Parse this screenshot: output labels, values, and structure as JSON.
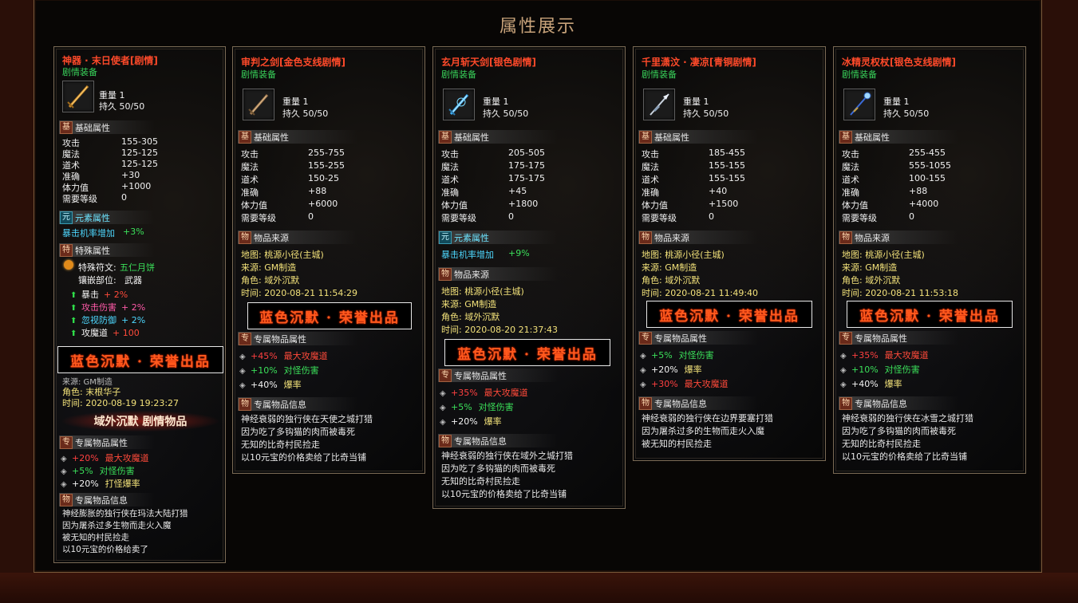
{
  "page": {
    "title": "属性展示"
  },
  "icons": {
    "weapon_card1": "golden-sword-icon",
    "weapon_card2": "bronze-sword-icon",
    "weapon_card3": "ice-sword-icon",
    "weapon_card4": "silver-spear-icon",
    "weapon_card5": "ice-staff-icon"
  },
  "colors": {
    "item_name": "#ff4a2a",
    "plot_equipment": "#39d25a",
    "brand_text": "#ff5a1e",
    "frame_border": "#7a5a3a",
    "title": "#c8a37a"
  },
  "cards": [
    {
      "name": "神器 · 末日使者[剧情]",
      "type": "剧情装备",
      "weight": "重量  1",
      "durability": "持久  50/50",
      "basic_title": "基础属性",
      "basic_badge": "基",
      "basic": [
        {
          "label": "攻击",
          "value": "155-305"
        },
        {
          "label": "魔法",
          "value": "125-125"
        },
        {
          "label": "道术",
          "value": "125-125"
        },
        {
          "label": "准确",
          "value": "+30"
        },
        {
          "label": "体力值",
          "value": "+1000"
        },
        {
          "label": "需要等级",
          "value": "0"
        }
      ],
      "element_badge": "元",
      "element_title": "元素属性",
      "element_stat": "暴击机率增加",
      "element_value": "+3%",
      "special_badge": "特",
      "special_title": "特殊属性",
      "special_rune_label": "特殊符文:",
      "special_rune_value": "五仁月饼",
      "special_slot_label": "镶嵌部位:",
      "special_slot_value": "武器",
      "special_lines": [
        {
          "label": "暴击",
          "value": "+ 2%"
        },
        {
          "label": "攻击伤害",
          "value": "+ 2%"
        },
        {
          "label": "忽视防御",
          "value": "+ 2%"
        },
        {
          "label": "攻魔道",
          "value": "+ 100"
        }
      ],
      "brand": "蓝色沉默 · 荣誉出品",
      "source_partial": "来源:  GM制造",
      "role": "角色:  末根华子",
      "time": "时间:  2020-08-19 19:23:27",
      "plot_banner": "域外沉默  剧情物品",
      "exclusive_badge": "专",
      "exclusive_title": "专属物品属性",
      "exclusive": [
        {
          "pct": "+20%",
          "stat": "最大攻魔道"
        },
        {
          "pct": "+5%",
          "stat": "对怪伤害"
        },
        {
          "pct": "+20%",
          "stat": "打怪爆率"
        }
      ],
      "info_badge": "物",
      "info_title": "专属物品信息",
      "info_lines": [
        "神经膨胀的独行侠在玛法大陆打猎",
        "因为屠杀过多生物而走火入魔",
        "被无知的村民捡走",
        "以10元宝的价格给卖了"
      ]
    },
    {
      "name": "审判之剑[金色支线剧情]",
      "type": "剧情装备",
      "weight": "重量  1",
      "durability": "持久  50/50",
      "basic_badge": "基",
      "basic_title": "基础属性",
      "basic": [
        {
          "label": "攻击",
          "value": "255-755"
        },
        {
          "label": "魔法",
          "value": "155-255"
        },
        {
          "label": "道术",
          "value": "150-25"
        },
        {
          "label": "准确",
          "value": "+88"
        },
        {
          "label": "体力值",
          "value": "+6000"
        },
        {
          "label": "需要等级",
          "value": "0"
        }
      ],
      "source_badge": "物",
      "source_title": "物品来源",
      "map": "地图:  桃源小径(主城)",
      "origin": "来源:  GM制造",
      "role": "角色:  域外沉默",
      "time": "时间:  2020-08-21 11:54:29",
      "brand": "蓝色沉默 · 荣誉出品",
      "exclusive_badge": "专",
      "exclusive_title": "专属物品属性",
      "exclusive": [
        {
          "pct": "+45%",
          "stat": "最大攻魔道"
        },
        {
          "pct": "+10%",
          "stat": "对怪伤害"
        },
        {
          "pct": "+40%",
          "stat": "爆率"
        }
      ],
      "info_badge": "物",
      "info_title": "专属物品信息",
      "info_lines": [
        "神经衰弱的独行侠在天使之城打猎",
        "因为吃了多钩猫的肉而被毒死",
        "无知的比奇村民捡走",
        "以10元宝的价格卖给了比奇当铺"
      ]
    },
    {
      "name": "玄月斩天剑[银色剧情]",
      "type": "剧情装备",
      "weight": "重量  1",
      "durability": "持久  50/50",
      "basic_badge": "基",
      "basic_title": "基础属性",
      "basic": [
        {
          "label": "攻击",
          "value": "205-505"
        },
        {
          "label": "魔法",
          "value": "175-175"
        },
        {
          "label": "道术",
          "value": "175-175"
        },
        {
          "label": "准确",
          "value": "+45"
        },
        {
          "label": "体力值",
          "value": "+1800"
        },
        {
          "label": "需要等级",
          "value": "0"
        }
      ],
      "element_badge": "元",
      "element_title": "元素属性",
      "element_stat": "暴击机率增加",
      "element_value": "+9%",
      "source_badge": "物",
      "source_title": "物品来源",
      "map": "地图:  桃源小径(主城)",
      "origin": "来源:  GM制造",
      "role": "角色:  域外沉默",
      "time": "时间:  2020-08-20 21:37:43",
      "brand": "蓝色沉默 · 荣誉出品",
      "exclusive_badge": "专",
      "exclusive_title": "专属物品属性",
      "exclusive": [
        {
          "pct": "+35%",
          "stat": "最大攻魔道"
        },
        {
          "pct": "+5%",
          "stat": "对怪伤害"
        },
        {
          "pct": "+20%",
          "stat": "爆率"
        }
      ],
      "info_badge": "物",
      "info_title": "专属物品信息",
      "info_lines": [
        "神经衰弱的独行侠在域外之城打猎",
        "因为吃了多钩猫的肉而被毒死",
        "无知的比奇村民捡走",
        "以10元宝的价格卖给了比奇当铺"
      ]
    },
    {
      "name": "千里潇汶 · 凄凉[青铜剧情]",
      "type": "剧情装备",
      "weight": "重量  1",
      "durability": "持久  50/50",
      "basic_badge": "基",
      "basic_title": "基础属性",
      "basic": [
        {
          "label": "攻击",
          "value": "185-455"
        },
        {
          "label": "魔法",
          "value": "155-155"
        },
        {
          "label": "道术",
          "value": "155-155"
        },
        {
          "label": "准确",
          "value": "+40"
        },
        {
          "label": "体力值",
          "value": "+1500"
        },
        {
          "label": "需要等级",
          "value": "0"
        }
      ],
      "source_badge": "物",
      "source_title": "物品来源",
      "map": "地图:  桃源小径(主城)",
      "origin": "来源:  GM制造",
      "role": "角色:  域外沉默",
      "time": "时间:  2020-08-21 11:49:40",
      "brand": "蓝色沉默 · 荣誉出品",
      "exclusive_badge": "专",
      "exclusive_title": "专属物品属性",
      "exclusive": [
        {
          "pct": "+5%",
          "stat": "对怪伤害"
        },
        {
          "pct": "+20%",
          "stat": "爆率"
        },
        {
          "pct": "+30%",
          "stat": "最大攻魔道"
        }
      ],
      "info_badge": "物",
      "info_title": "专属物品信息",
      "info_lines": [
        "神经衰弱的独行侠在边界要塞打猎",
        "因为屠杀过多的生物而走火入魔",
        "被无知的村民捡走"
      ]
    },
    {
      "name": "冰精灵权杖[银色支线剧情]",
      "type": "剧情装备",
      "weight": "重量  1",
      "durability": "持久  50/50",
      "basic_badge": "基",
      "basic_title": "基础属性",
      "basic": [
        {
          "label": "攻击",
          "value": "255-455"
        },
        {
          "label": "魔法",
          "value": "555-1055"
        },
        {
          "label": "道术",
          "value": "100-155"
        },
        {
          "label": "准确",
          "value": "+88"
        },
        {
          "label": "体力值",
          "value": "+4000"
        },
        {
          "label": "需要等级",
          "value": "0"
        }
      ],
      "source_badge": "物",
      "source_title": "物品来源",
      "map": "地图:  桃源小径(主城)",
      "origin": "来源:  GM制造",
      "role": "角色:  域外沉默",
      "time": "时间:  2020-08-21 11:53:18",
      "brand": "蓝色沉默 · 荣誉出品",
      "exclusive_badge": "专",
      "exclusive_title": "专属物品属性",
      "exclusive": [
        {
          "pct": "+35%",
          "stat": "最大攻魔道"
        },
        {
          "pct": "+10%",
          "stat": "对怪伤害"
        },
        {
          "pct": "+40%",
          "stat": "爆率"
        }
      ],
      "info_badge": "物",
      "info_title": "专属物品信息",
      "info_lines": [
        "神经衰弱的独行侠在冰雪之城打猎",
        "因为吃了多钩猫的肉而被毒死",
        "无知的比奇村民捡走",
        "以10元宝的价格卖给了比奇当铺"
      ]
    }
  ]
}
